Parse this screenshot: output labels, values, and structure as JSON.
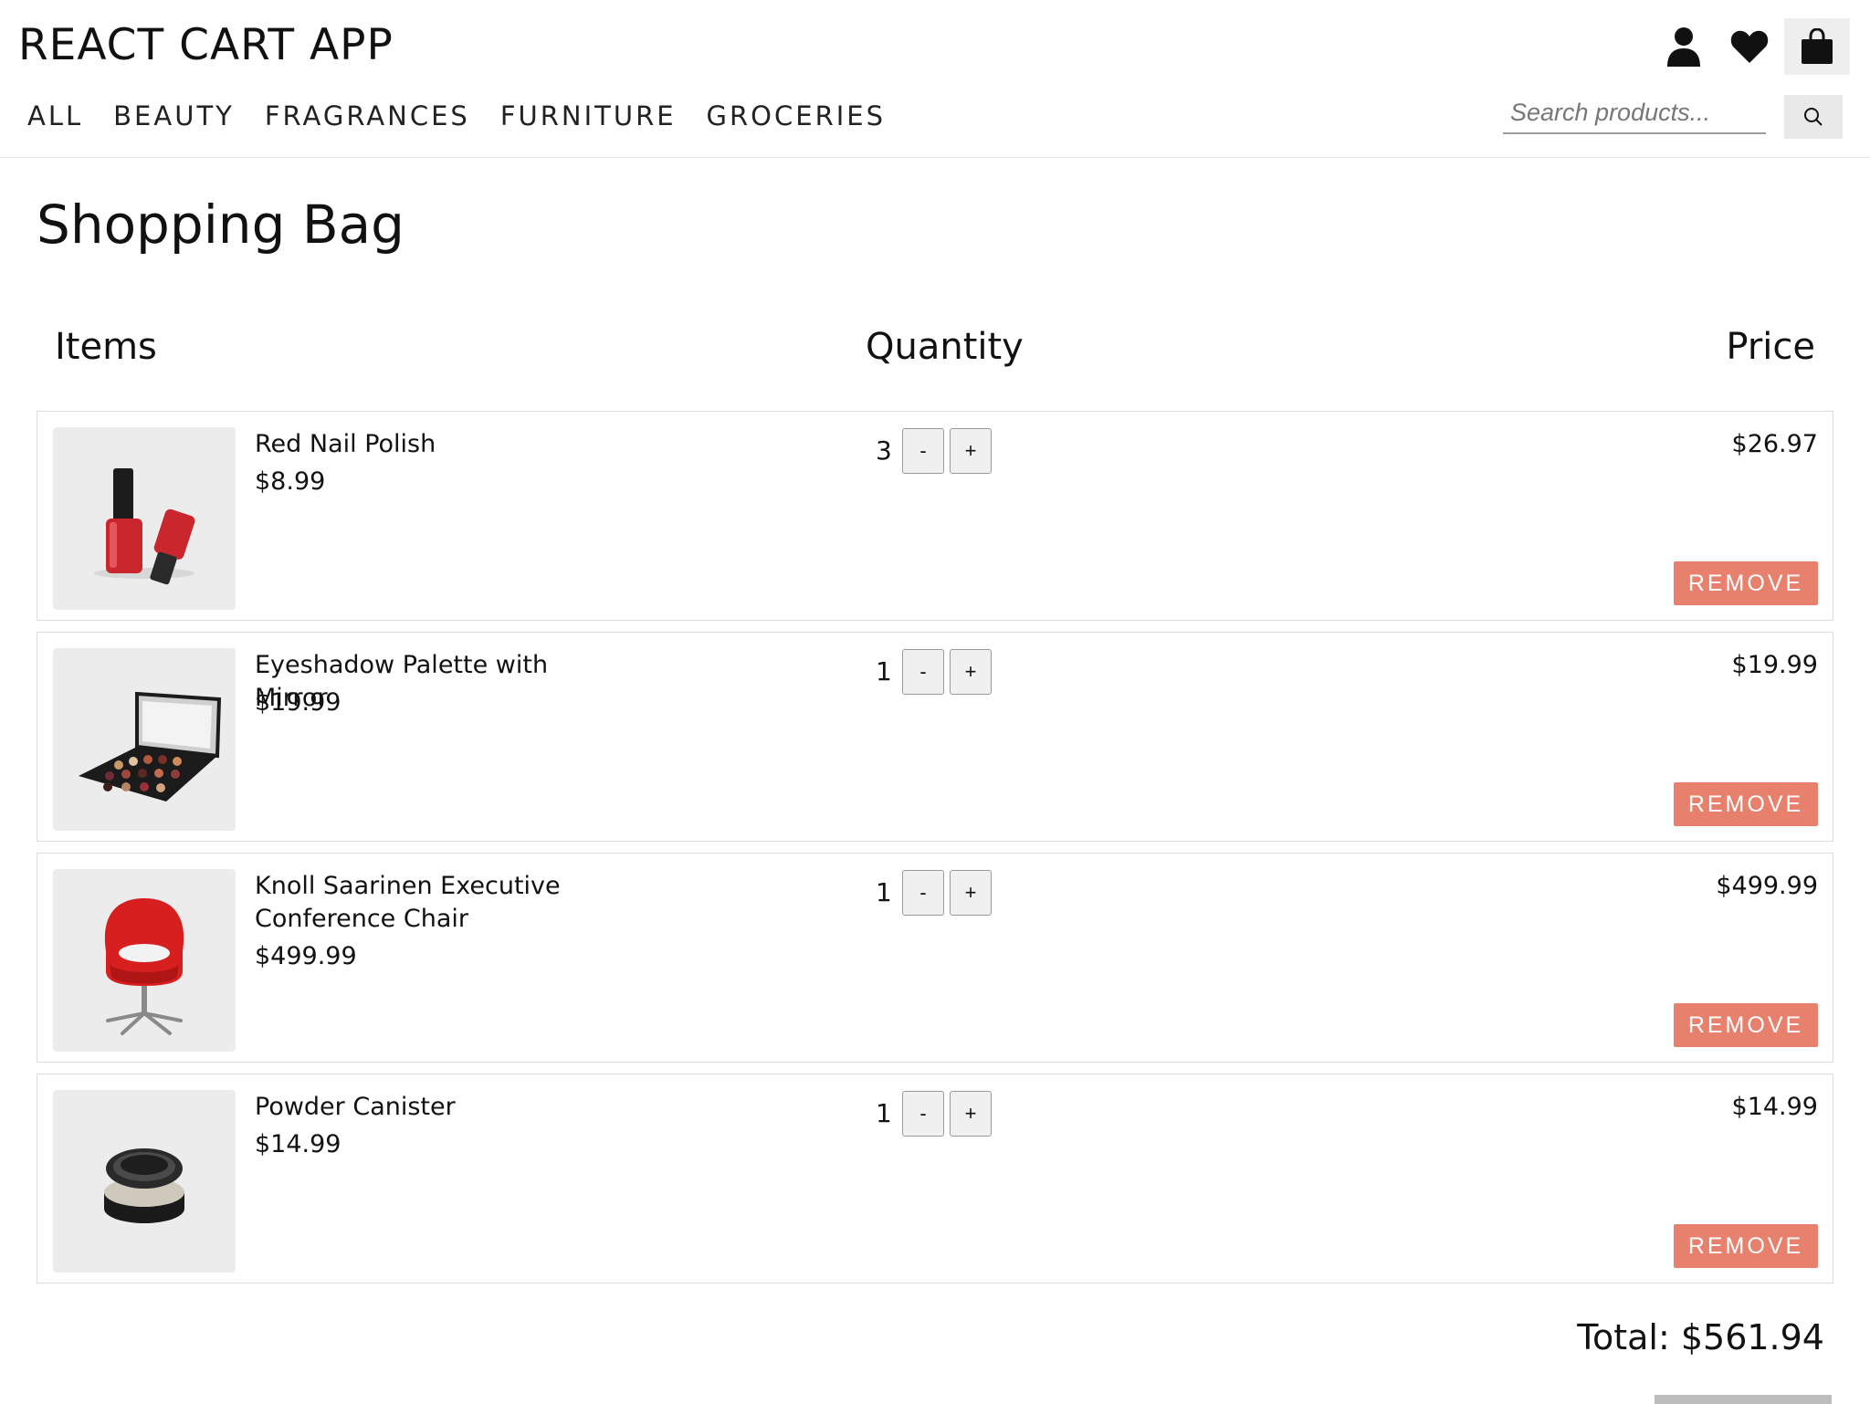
{
  "app": {
    "title": "REACT CART APP"
  },
  "nav": {
    "items": [
      "ALL",
      "BEAUTY",
      "FRAGRANCES",
      "FURNITURE",
      "GROCERIES"
    ]
  },
  "header_icons": [
    "user-icon",
    "heart-icon",
    "shopping-bag-icon"
  ],
  "search": {
    "placeholder": "Search products...",
    "value": ""
  },
  "page": {
    "title": "Shopping Bag"
  },
  "columns": {
    "items": "Items",
    "quantity": "Quantity",
    "price": "Price"
  },
  "items": [
    {
      "name": "Red Nail Polish",
      "unit_price": "$8.99",
      "quantity": "3",
      "line_price": "$26.97",
      "remove_label": "REMOVE",
      "minus_label": "-",
      "plus_label": "+"
    },
    {
      "name": "Eyeshadow Palette with Mirror",
      "unit_price": "$19.99",
      "quantity": "1",
      "line_price": "$19.99",
      "remove_label": "REMOVE",
      "minus_label": "-",
      "plus_label": "+"
    },
    {
      "name": "Knoll Saarinen Executive Conference Chair",
      "unit_price": "$499.99",
      "quantity": "1",
      "line_price": "$499.99",
      "remove_label": "REMOVE",
      "minus_label": "-",
      "plus_label": "+"
    },
    {
      "name": "Powder Canister",
      "unit_price": "$14.99",
      "quantity": "1",
      "line_price": "$14.99",
      "remove_label": "REMOVE",
      "minus_label": "-",
      "plus_label": "+"
    }
  ],
  "total": {
    "text": "Total: $561.94"
  },
  "colors": {
    "remove_button": "#e8806e",
    "thumb_bg": "#ececec"
  }
}
